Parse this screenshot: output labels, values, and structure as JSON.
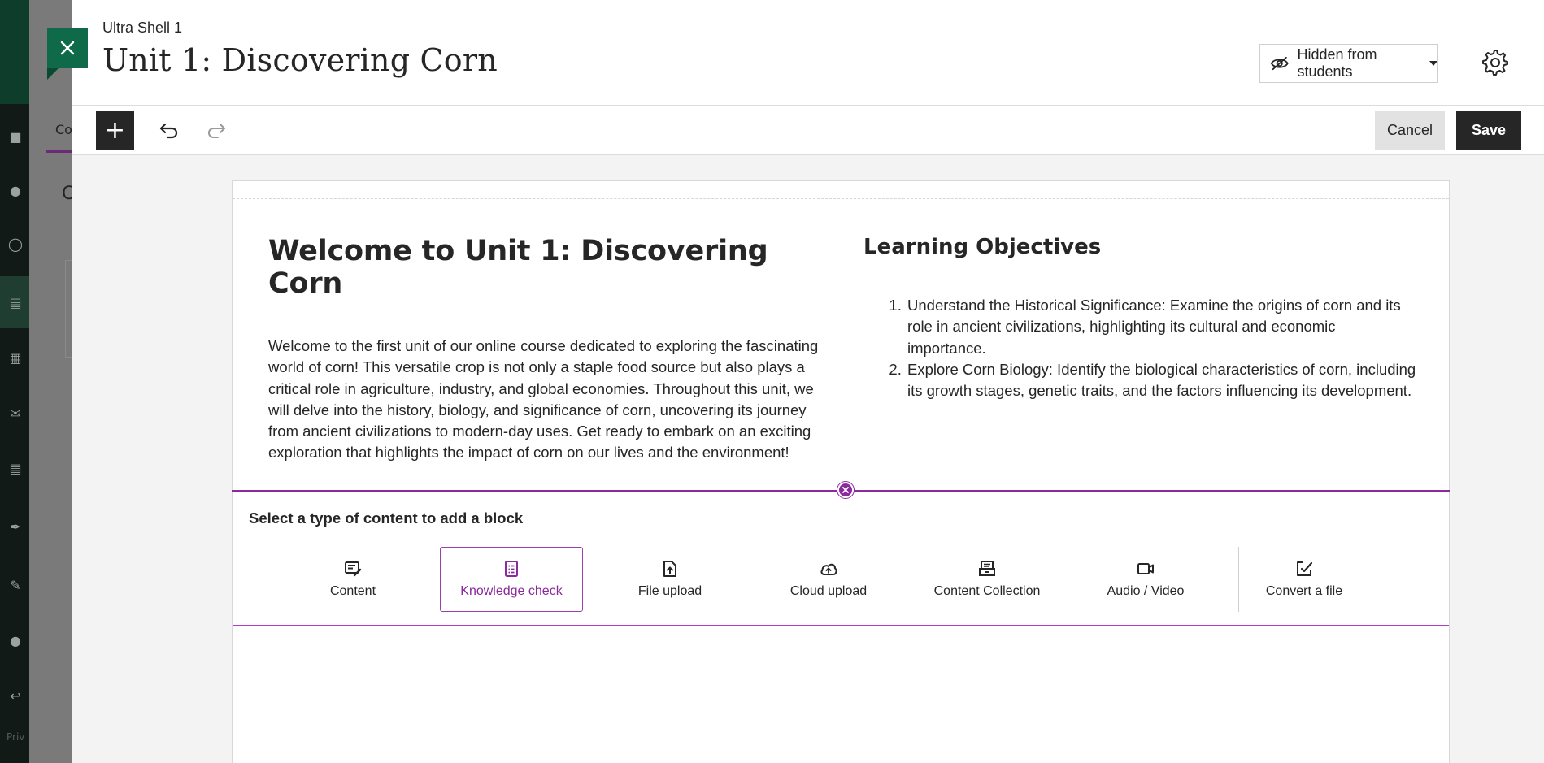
{
  "background": {
    "tab_partial": "Co",
    "heading_partial": "C",
    "footer_partial": "Priv"
  },
  "header": {
    "course_name": "Ultra Shell 1",
    "page_title": "Unit 1: Discovering Corn",
    "visibility": "Hidden from students",
    "close_icon": "close-icon",
    "settings_icon": "gear-icon"
  },
  "toolbar": {
    "add_label": "+",
    "undo_icon": "undo-icon",
    "redo_icon": "redo-icon",
    "cancel_label": "Cancel",
    "save_label": "Save"
  },
  "document": {
    "welcome_heading": "Welcome to Unit 1: Discovering Corn",
    "welcome_text": "Welcome to the first unit of our online course dedicated to exploring the fascinating world of corn! This versatile crop is not only a staple food source but also plays a critical role in agriculture, industry, and global economies. Throughout this unit, we will delve into the history, biology, and significance of corn, uncovering its journey from ancient civilizations to modern-day uses. Get ready to embark on an exciting exploration that highlights the impact of corn on our lives and the environment!",
    "objectives_heading": "Learning Objectives",
    "objectives": [
      "Understand the Historical Significance: Examine the origins of corn and its role in ancient civilizations, highlighting its cultural and economic importance.",
      "Explore Corn Biology: Identify the biological characteristics of corn, including its growth stages, genetic traits, and the factors influencing its development."
    ]
  },
  "insert_panel": {
    "title": "Select a type of content to add a block",
    "options": [
      {
        "label": "Content",
        "icon": "content-icon",
        "selected": false
      },
      {
        "label": "Knowledge check",
        "icon": "knowledge-check-icon",
        "selected": true
      },
      {
        "label": "File upload",
        "icon": "file-upload-icon",
        "selected": false
      },
      {
        "label": "Cloud upload",
        "icon": "cloud-upload-icon",
        "selected": false
      },
      {
        "label": "Content Collection",
        "icon": "content-collection-icon",
        "selected": false
      },
      {
        "label": "Audio / Video",
        "icon": "audio-video-icon",
        "selected": false
      },
      {
        "label": "Convert a file",
        "icon": "convert-file-icon",
        "selected": false
      }
    ]
  },
  "colors": {
    "brand_green": "#0f6a4a",
    "accent_purple": "#8a2a9c",
    "dark": "#262626"
  },
  "help_label": "?"
}
